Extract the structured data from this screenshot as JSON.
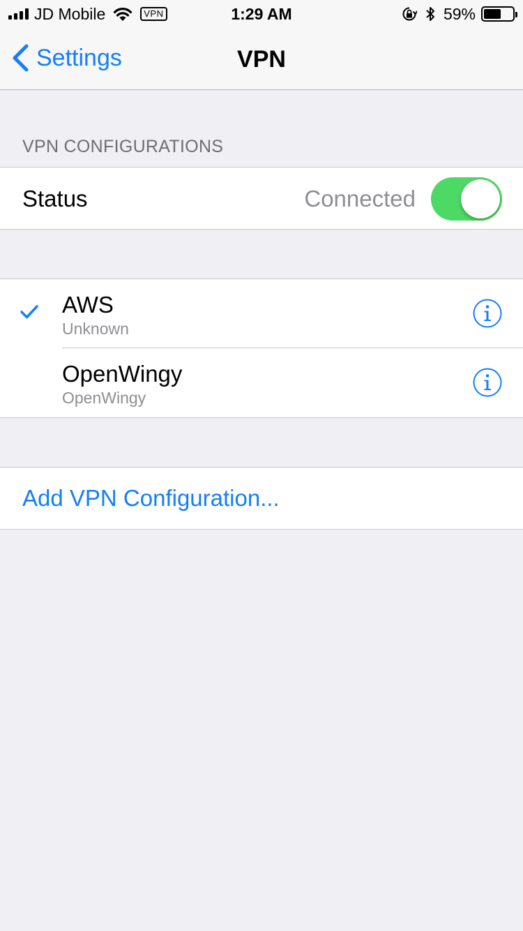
{
  "status_bar": {
    "carrier": "JD Mobile",
    "vpn_badge": "VPN",
    "time": "1:29 AM",
    "battery_percent": "59%",
    "battery_level": 0.59,
    "icons": [
      "signal-icon",
      "wifi-icon",
      "rotation-lock-icon",
      "bluetooth-icon",
      "battery-icon"
    ]
  },
  "nav": {
    "back_label": "Settings",
    "title": "VPN"
  },
  "section": {
    "header": "VPN CONFIGURATIONS"
  },
  "status_row": {
    "label": "Status",
    "value": "Connected",
    "toggle_on": true
  },
  "configs": [
    {
      "name": "AWS",
      "subtitle": "Unknown",
      "selected": true
    },
    {
      "name": "OpenWingy",
      "subtitle": "OpenWingy",
      "selected": false
    }
  ],
  "add_label": "Add VPN Configuration...",
  "colors": {
    "accent": "#147efb",
    "toggle_on": "#4cd964",
    "background": "#efeff4",
    "secondary_text": "#8e8e93"
  }
}
